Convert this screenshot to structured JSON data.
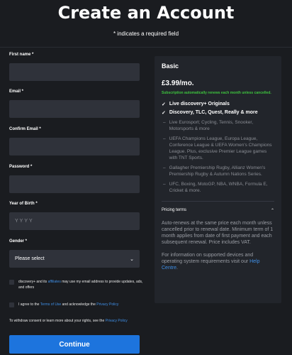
{
  "header": {
    "title": "Create an Account",
    "required_note": "* indicates a required field"
  },
  "form": {
    "first_name_label": "First name *",
    "email_label": "Email *",
    "confirm_email_label": "Confirm Email *",
    "password_label": "Password *",
    "yob_label": "Year of Birth *",
    "yob_placeholder": "YYYY",
    "gender_label": "Gender *",
    "gender_value": "Please select",
    "consent1_text_a": "discovery+ and its ",
    "consent1_link": "affiliates",
    "consent1_text_b": " may use my email address to provide updates, ads, and offers",
    "consent2_text_a": "I agree to the ",
    "consent2_link1": "Terms of Use",
    "consent2_text_b": " and acknowledge the ",
    "consent2_link2": "Privacy Policy",
    "withdraw_text": "To withdraw consent or learn more about your rights, see the ",
    "withdraw_link": "Privacy Policy",
    "continue_label": "Continue"
  },
  "plan": {
    "name": "Basic",
    "price": "£3.99/mo.",
    "renew_note": "Subscription automatically renews each month unless cancelled.",
    "features": [
      "Live discovery+ Originals",
      "Discovery, TLC, Quest, Really & more"
    ],
    "sub_items": [
      "Live Eurosport; Cycling, Tennis, Snooker, Motorsports & more",
      "UEFA Champions League, Europa League, Conference League & UEFA Women's Champions League. Plus, exclusive Premier League games with TNT Sports.",
      "Gallagher Premiership Rugby, Allianz Women's Premiership Rugby & Autumn Nations Series.",
      "UFC, Boxing, MotoGP, NBA, WNBA, Formula E, Cricket & more."
    ],
    "pricing_terms_label": "Pricing terms",
    "terms_p1": "Auto-renews at the same price each month unless cancelled prior to renewal date. Minimum term of 1 month applies from date of first payment and each subsequent renewal. Price includes VAT.",
    "terms_p2_a": "For information on supported devices and operating system requirements visit our ",
    "terms_p2_link": "Help Centre",
    "terms_p2_b": "."
  },
  "colors": {
    "accent": "#1d74dd",
    "link": "#3f8fe6",
    "renew_green": "#3ec43e"
  }
}
